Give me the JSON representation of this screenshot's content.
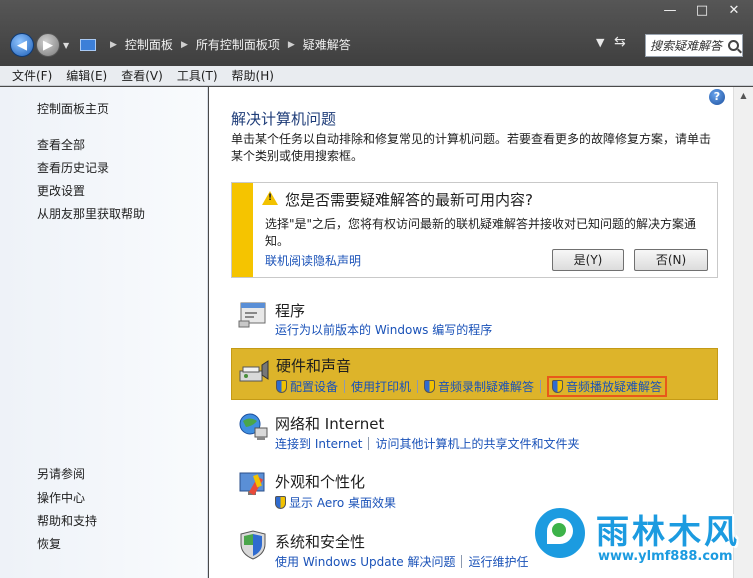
{
  "window": {
    "minimize": "—",
    "maximize": "□",
    "close": "✕"
  },
  "breadcrumb": [
    "控制面板",
    "所有控制面板项",
    "疑难解答"
  ],
  "search": {
    "placeholder": "搜索疑难解答"
  },
  "menu": [
    "文件(F)",
    "编辑(E)",
    "查看(V)",
    "工具(T)",
    "帮助(H)"
  ],
  "sidebar": {
    "home": "控制面板主页",
    "links": [
      "查看全部",
      "查看历史记录",
      "更改设置",
      "从朋友那里获取帮助"
    ],
    "see_also_title": "另请参阅",
    "see_also": [
      "操作中心",
      "帮助和支持",
      "恢复"
    ]
  },
  "main": {
    "title": "解决计算机问题",
    "description": "单击某个任务以自动排除和修复常见的计算机问题。若要查看更多的故障修复方案，请单击某个类别或使用搜索框。",
    "help": "?"
  },
  "notice": {
    "title": "您是否需要疑难解答的最新可用内容?",
    "body": "选择\"是\"之后，您将有权访问最新的联机疑难解答并接收对已知问题的解决方案通知。",
    "privacy_link": "联机阅读隐私声明",
    "yes_label": "是(Y)",
    "no_label": "否(N)"
  },
  "categories": [
    {
      "title": "程序",
      "links": [
        "运行为以前版本的 Windows 编写的程序"
      ]
    },
    {
      "title": "硬件和声音",
      "links": [
        "配置设备",
        "使用打印机",
        "音频录制疑难解答",
        "音频播放疑难解答"
      ]
    },
    {
      "title": "网络和 Internet",
      "links": [
        "连接到 Internet",
        "访问其他计算机上的共享文件和文件夹"
      ]
    },
    {
      "title": "外观和个性化",
      "links": [
        "显示 Aero 桌面效果"
      ]
    },
    {
      "title": "系统和安全性",
      "links": [
        "使用 Windows Update 解决问题",
        "运行维护任"
      ]
    }
  ],
  "watermark": {
    "title": "雨林木风",
    "url": "www.ylmf888.com"
  },
  "colors": {
    "link": "#1a52b8",
    "highlight": "#ddb42a",
    "notice_bar": "#f5c400",
    "title": "#1e3c78"
  }
}
